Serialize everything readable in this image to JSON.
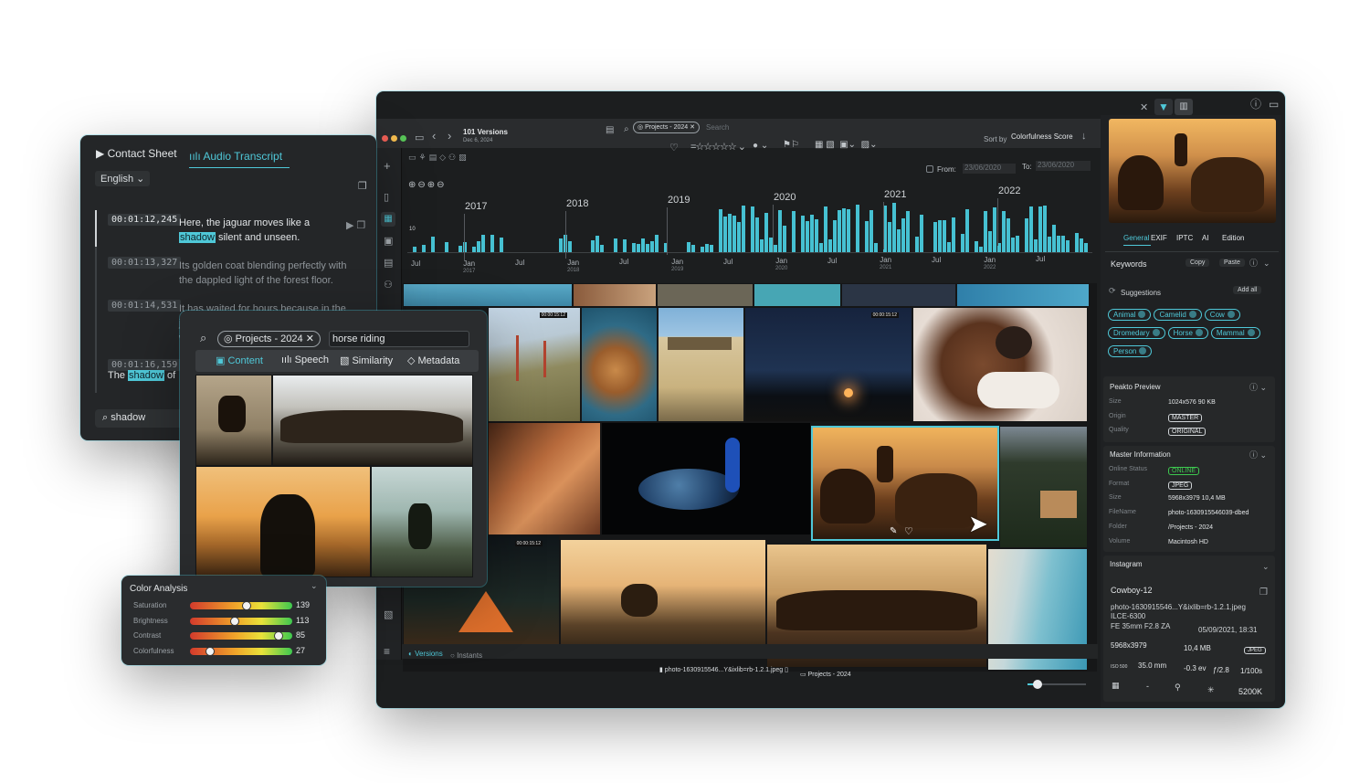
{
  "main_window": {
    "versions_count": "101 Versions",
    "date": "Dec 6, 2024",
    "project_tag": "Projects - 2024",
    "search_placeholder": "Search",
    "sort_by_label": "Sort by",
    "sort_value": "Colorfulness Score",
    "from_label": "From:",
    "from_value": "23/06/2020",
    "to_label": "To:",
    "to_value": "23/06/2020",
    "bottom_tabs": [
      "Versions",
      "Instants"
    ],
    "bottom_file": "photo-1630915546...Y&ixlib=rb-1.2.1.jpeg",
    "bottom_folder": "Projects - 2024"
  },
  "timeline": {
    "years": [
      "2017",
      "2018",
      "2019",
      "2020",
      "2021",
      "2022"
    ],
    "y_tick": "10",
    "axis_labels": [
      {
        "m": "Jul",
        "y": ""
      },
      {
        "m": "Jan",
        "y": "2017"
      },
      {
        "m": "Jul",
        "y": ""
      },
      {
        "m": "Jan",
        "y": "2018"
      },
      {
        "m": "Jul",
        "y": ""
      },
      {
        "m": "Jan",
        "y": "2019"
      },
      {
        "m": "Jul",
        "y": ""
      },
      {
        "m": "Jan",
        "y": "2020"
      },
      {
        "m": "Jul",
        "y": ""
      },
      {
        "m": "Jan",
        "y": "2021"
      },
      {
        "m": "Jul",
        "y": ""
      },
      {
        "m": "Jan",
        "y": "2022"
      },
      {
        "m": "Jul",
        "y": ""
      }
    ]
  },
  "thumbs_durations": [
    "00:00:15:12",
    "00:00:15:12",
    "00:00:15:12"
  ],
  "inspector": {
    "tabs": [
      "General",
      "EXIF",
      "IPTC",
      "AI",
      "Edition"
    ],
    "active_tab": "General",
    "keywords_title": "Keywords",
    "copy_label": "Copy",
    "paste_label": "Paste",
    "suggestions_label": "Suggestions",
    "add_all_label": "Add all",
    "keywords": [
      "Animal",
      "Camelid",
      "Cow",
      "Dromedary",
      "Horse",
      "Mammal",
      "Person"
    ],
    "preview_title": "Peakto Preview",
    "preview_rows": [
      {
        "k": "Size",
        "v": "1024x576  90 KB"
      },
      {
        "k": "Origin",
        "v": "MASTER"
      },
      {
        "k": "Quality",
        "v": "ORIGINAL"
      }
    ],
    "master_title": "Master Information",
    "master_rows": [
      {
        "k": "Online Status",
        "v": "ONLINE"
      },
      {
        "k": "Format",
        "v": "JPEG"
      },
      {
        "k": "Size",
        "v": "5968x3979  10,4 MB"
      },
      {
        "k": "FileName",
        "v": "photo-1630915546039-dbed"
      },
      {
        "k": "Folder",
        "v": "/Projects - 2024"
      },
      {
        "k": "Volume",
        "v": "Macintosh HD"
      }
    ],
    "instagram_title": "Instagram",
    "insta": {
      "name": "Cowboy-12",
      "file": "photo-1630915546...Y&ixlib=rb-1.2.1.jpeg",
      "camera": "ILCE-6300",
      "lens": "FE 35mm F2.8 ZA",
      "date": "05/09/2021, 18:31",
      "dims": "5968x3979",
      "size": "10,4 MB",
      "format": "JPEG",
      "iso_label": "ISO 500",
      "focal": "35.0 mm",
      "ev": "-0.3 ev",
      "aperture": "ƒ/2.8",
      "shutter": "1/100s",
      "wb_dash": "-",
      "temp": "5200K"
    }
  },
  "transcript_window": {
    "tab_contact": "Contact Sheet",
    "tab_audio": "Audio Transcript",
    "language": "English",
    "entries": [
      {
        "time": "00:01:12,245",
        "pre": "Here, the jaguar moves like a",
        "hl": "shadow",
        "post": "silent and unseen."
      },
      {
        "time": "00:01:13,327",
        "pre": "Its golden coat blending perfectly with the dappled light of the forest floor.",
        "hl": "",
        "post": ""
      },
      {
        "time": "00:01:14,531",
        "pre": "It has waited for hours because in the jungle, timing is everything. It waits, it watches",
        "hl": "",
        "post": ""
      },
      {
        "time": "00:01:16,159",
        "pre": "The",
        "hl": "shadow",
        "post": "of"
      }
    ],
    "search_value": "shadow"
  },
  "search_popup": {
    "scope": "Projects - 2024",
    "query": "horse riding",
    "modes": [
      "Content",
      "Speech",
      "Similarity",
      "Metadata"
    ]
  },
  "color_analysis": {
    "title": "Color Analysis",
    "rows": [
      {
        "label": "Saturation",
        "value": "139",
        "level": 0.55
      },
      {
        "label": "Brightness",
        "value": "113",
        "level": 0.44
      },
      {
        "label": "Contrast",
        "value": "85",
        "level": 0.87
      },
      {
        "label": "Colorfulness",
        "value": "27",
        "level": 0.2
      }
    ]
  },
  "colors": {
    "accent": "#4fc8d8",
    "bg": "#1f2123",
    "panel": "#262829"
  }
}
